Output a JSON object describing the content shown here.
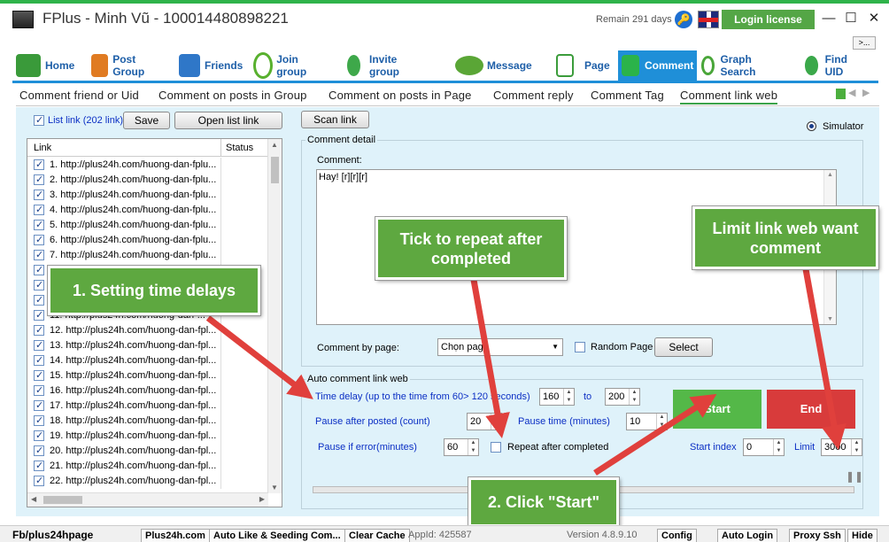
{
  "window": {
    "title": "FPlus - Minh Vũ - 100014480898221",
    "remain": "Remain 291 days",
    "login_license": "Login license",
    "min": "—",
    "max": "☐",
    "close": "✕",
    "more": ">..."
  },
  "nav": [
    {
      "label": "Home",
      "icon": "house-icon",
      "color": "#3a9a3a"
    },
    {
      "label": "Post Group",
      "icon": "people-icon",
      "color": "#e07b22"
    },
    {
      "label": "Friends",
      "icon": "friends-icon",
      "color": "#2f77c8"
    },
    {
      "label": "Join group",
      "icon": "join-group-icon",
      "color": "#58b02e"
    },
    {
      "label": "Invite group",
      "icon": "invite-icon",
      "color": "#3ea84a"
    },
    {
      "label": "Message",
      "icon": "message-icon",
      "color": "#5aa636"
    },
    {
      "label": "Page",
      "icon": "page-icon",
      "color": "#3b9c3b"
    },
    {
      "label": "Comment",
      "icon": "comment-up-arrow-icon",
      "color": "#2bb34a"
    },
    {
      "label": "Graph Search",
      "icon": "search-icon",
      "color": "#4aa63a"
    },
    {
      "label": "Find UID",
      "icon": "find-uid-icon",
      "color": "#3aa84a"
    }
  ],
  "subtabs": [
    "Comment friend or Uid",
    "Comment on posts in Group",
    "Comment on posts in Page",
    "Comment reply",
    "Comment Tag",
    "Comment link web"
  ],
  "left": {
    "list_link_label": "List link (202 link)",
    "list_link_checked": true,
    "save": "Save",
    "open_list_link": "Open list link",
    "col_link": "Link",
    "col_status": "Status",
    "rows": [
      "1. http://plus24h.com/huong-dan-fplu...",
      "2. http://plus24h.com/huong-dan-fplu...",
      "3. http://plus24h.com/huong-dan-fplu...",
      "4. http://plus24h.com/huong-dan-fplu...",
      "5. http://plus24h.com/huong-dan-fplu...",
      "6. http://plus24h.com/huong-dan-fplu...",
      "7. http://plus24h.com/huong-dan-fplu...",
      "",
      "",
      "",
      "11. http://plus24h.com/huong-dan-...",
      "12. http://plus24h.com/huong-dan-fpl...",
      "13. http://plus24h.com/huong-dan-fpl...",
      "14. http://plus24h.com/huong-dan-fpl...",
      "15. http://plus24h.com/huong-dan-fpl...",
      "16. http://plus24h.com/huong-dan-fpl...",
      "17. http://plus24h.com/huong-dan-fpl...",
      "18. http://plus24h.com/huong-dan-fpl...",
      "19. http://plus24h.com/huong-dan-fpl...",
      "20. http://plus24h.com/huong-dan-fpl...",
      "21. http://plus24h.com/huong-dan-fpl...",
      "22. http://plus24h.com/huong-dan-fpl..."
    ]
  },
  "right": {
    "scan_link": "Scan link",
    "simulator": "Simulator",
    "comment_detail": "Comment detail",
    "comment_label": "Comment:",
    "comment_value": "Hay! [r][r][r]",
    "comment_by_page": "Comment by page:",
    "page_select": "Chọn page",
    "random_page": "Random Page",
    "select": "Select",
    "auto_title": "Auto comment link web",
    "time_delay": "Time delay (up to the time from 60> 120 seconds)",
    "delay_from": "160",
    "to": "to",
    "delay_to": "200",
    "pause_after_posted": "Pause after posted (count)",
    "pause_count": "20",
    "pause_time": "Pause time (minutes)",
    "pause_time_value": "10",
    "pause_if_error": "Pause if error(minutes)",
    "pause_error_value": "60",
    "repeat": "Repeat after completed",
    "start": "Start",
    "end": "End",
    "start_index": "Start index",
    "start_index_value": "0",
    "limit": "Limit",
    "limit_value": "3000"
  },
  "callouts": {
    "delays": "1. Setting time delays",
    "repeat": "Tick to repeat after completed",
    "limit": "Limit link web want comment",
    "start": "2. Click \"Start\""
  },
  "status": {
    "fb": "Fb/plus24hpage",
    "site": "Plus24h.com",
    "auto_like": "Auto Like & Seeding Com...",
    "clear_cache": "Clear Cache",
    "appid": "AppId: 425587",
    "version": "Version 4.8.9.10",
    "config": "Config",
    "auto_login": "Auto Login",
    "proxy": "Proxy Ssh",
    "hide": "Hide"
  },
  "colors": {
    "accent_blue": "#1f8fd8",
    "start_green": "#54b848",
    "end_red": "#d83b3b",
    "callout_green": "#5ea840",
    "arrow_red": "#e0403c"
  }
}
